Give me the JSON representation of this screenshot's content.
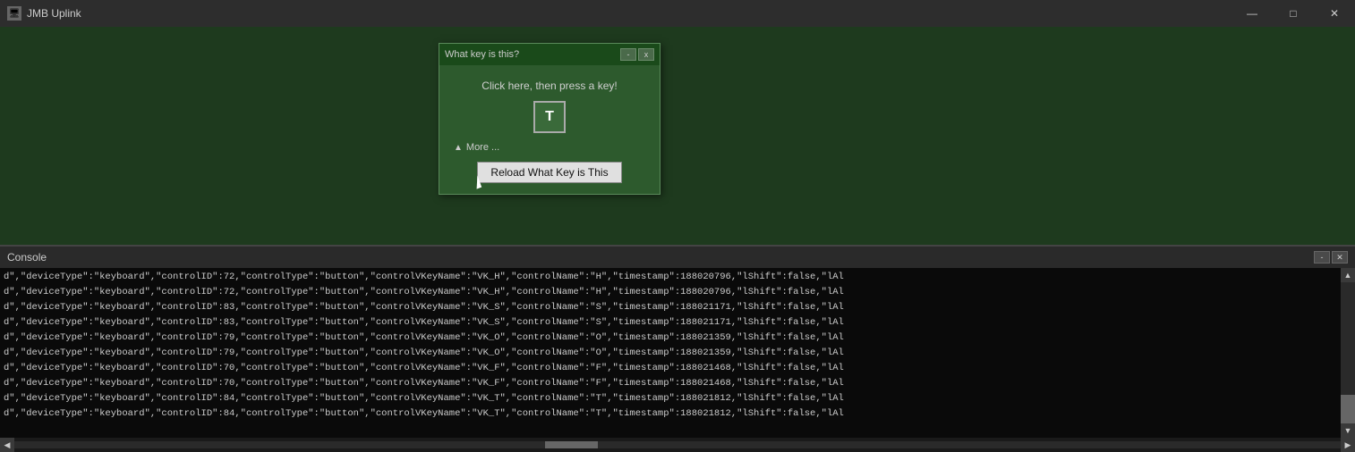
{
  "app": {
    "title": "JMB Uplink",
    "titlebar_icon": "🖥",
    "minimize_label": "—",
    "maximize_label": "□",
    "close_label": "✕"
  },
  "dialog": {
    "title": "What key is this?",
    "minimize_label": "-",
    "close_label": "x",
    "instruction": "Click here, then press a key!",
    "key_display": "T",
    "more_label": "More ...",
    "reload_button_label": "Reload What Key is This"
  },
  "console": {
    "title": "Console",
    "minimize_label": "-",
    "close_label": "✕",
    "lines": [
      "d\",\"deviceType\":\"keyboard\",\"controlID\":72,\"controlType\":\"button\",\"controlVKeyName\":\"VK_H\",\"controlName\":\"H\",\"timestamp\":188020796,\"lShift\":false,\"lAl",
      "d\",\"deviceType\":\"keyboard\",\"controlID\":72,\"controlType\":\"button\",\"controlVKeyName\":\"VK_H\",\"controlName\":\"H\",\"timestamp\":188020796,\"lShift\":false,\"lAl",
      "d\",\"deviceType\":\"keyboard\",\"controlID\":83,\"controlType\":\"button\",\"controlVKeyName\":\"VK_S\",\"controlName\":\"S\",\"timestamp\":188021171,\"lShift\":false,\"lAl",
      "d\",\"deviceType\":\"keyboard\",\"controlID\":83,\"controlType\":\"button\",\"controlVKeyName\":\"VK_S\",\"controlName\":\"S\",\"timestamp\":188021171,\"lShift\":false,\"lAl",
      "d\",\"deviceType\":\"keyboard\",\"controlID\":79,\"controlType\":\"button\",\"controlVKeyName\":\"VK_O\",\"controlName\":\"O\",\"timestamp\":188021359,\"lShift\":false,\"lAl",
      "d\",\"deviceType\":\"keyboard\",\"controlID\":79,\"controlType\":\"button\",\"controlVKeyName\":\"VK_O\",\"controlName\":\"O\",\"timestamp\":188021359,\"lShift\":false,\"lAl",
      "d\",\"deviceType\":\"keyboard\",\"controlID\":70,\"controlType\":\"button\",\"controlVKeyName\":\"VK_F\",\"controlName\":\"F\",\"timestamp\":188021468,\"lShift\":false,\"lAl",
      "d\",\"deviceType\":\"keyboard\",\"controlID\":70,\"controlType\":\"button\",\"controlVKeyName\":\"VK_F\",\"controlName\":\"F\",\"timestamp\":188021468,\"lShift\":false,\"lAl",
      "d\",\"deviceType\":\"keyboard\",\"controlID\":84,\"controlType\":\"button\",\"controlVKeyName\":\"VK_T\",\"controlName\":\"T\",\"timestamp\":188021812,\"lShift\":false,\"lAl",
      "d\",\"deviceType\":\"keyboard\",\"controlID\":84,\"controlType\":\"button\",\"controlVKeyName\":\"VK_T\",\"controlName\":\"T\",\"timestamp\":188021812,\"lShift\":false,\"lAl"
    ]
  }
}
